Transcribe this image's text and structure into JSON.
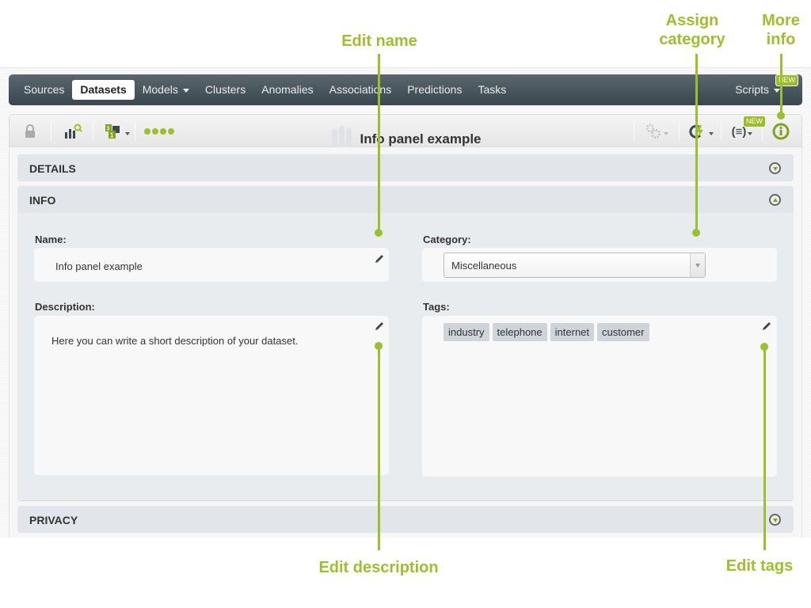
{
  "nav": {
    "items": [
      {
        "label": "Sources",
        "active": false
      },
      {
        "label": "Datasets",
        "active": true
      },
      {
        "label": "Models",
        "active": false,
        "dropdown": true
      },
      {
        "label": "Clusters",
        "active": false
      },
      {
        "label": "Anomalies",
        "active": false
      },
      {
        "label": "Associations",
        "active": false
      },
      {
        "label": "Predictions",
        "active": false
      },
      {
        "label": "Tasks",
        "active": false
      }
    ],
    "scripts_label": "Scripts",
    "scripts_badge": "NEW"
  },
  "toolbar": {
    "title": "Info panel example",
    "icons": [
      "lock-icon",
      "dataset-search-icon",
      "sample-dataset-icon",
      "progress-dots-icon",
      "configure-icon",
      "one-click-model-icon",
      "flatline-editor-icon",
      "info-icon"
    ],
    "flatline_badge": "NEW"
  },
  "sections": {
    "details": "DETAILS",
    "info": "INFO",
    "privacy": "PRIVACY"
  },
  "info": {
    "name_label": "Name:",
    "name_value": "Info panel example",
    "category_label": "Category:",
    "category_value": "Miscellaneous",
    "description_label": "Description:",
    "description_value": "Here you can write a short description of your dataset.",
    "tags_label": "Tags:",
    "tags": [
      "industry",
      "telephone",
      "internet",
      "customer"
    ]
  },
  "annotations": {
    "edit_name": "Edit name",
    "assign_category_line1": "Assign",
    "assign_category_line2": "category",
    "more_info_line1": "More",
    "more_info_line2": "info",
    "edit_description": "Edit description",
    "edit_tags": "Edit tags"
  },
  "colors": {
    "accent": "#9bc02a",
    "navbar": "#3a464d"
  }
}
